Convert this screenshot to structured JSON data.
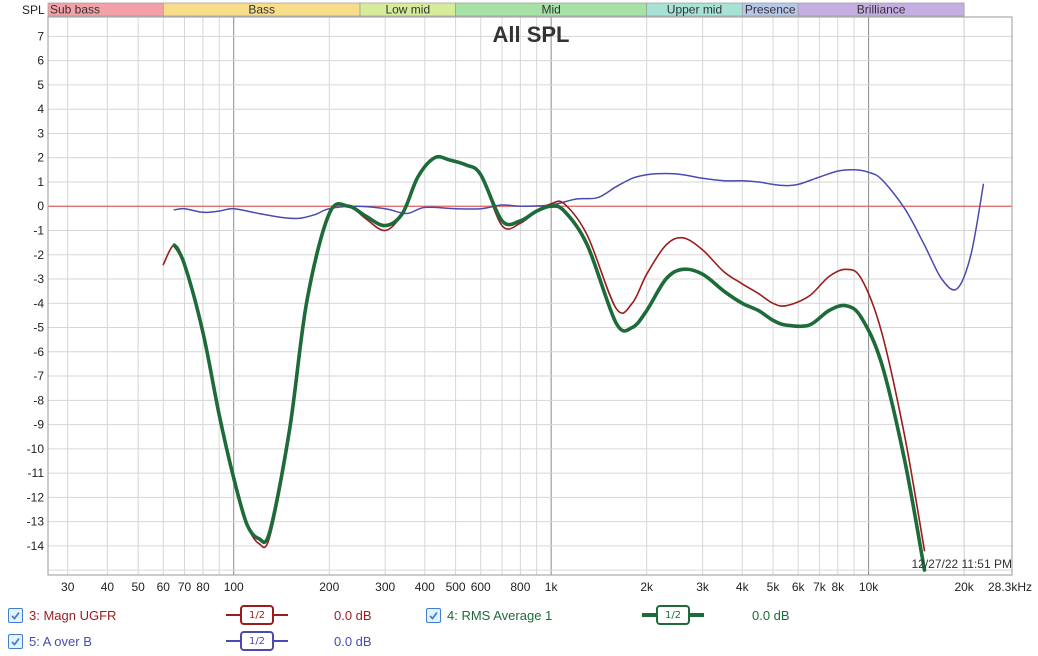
{
  "colors": {
    "series3": "#9b1c1c",
    "series4": "#1e6b3a",
    "series5": "#4a4ab0",
    "zero_line": "#e06060",
    "grid": "#d6d6d6",
    "grid_major": "#8a8a8a",
    "checkbox": "#3f7fd1"
  },
  "bands": [
    {
      "label": "Sub bass",
      "color": "#f4a0a8"
    },
    {
      "label": "Bass",
      "color": "#f7dc8a"
    },
    {
      "label": "Low mid",
      "color": "#d6ec9a"
    },
    {
      "label": "Mid",
      "color": "#a6e2a6"
    },
    {
      "label": "Upper mid",
      "color": "#a6e2d6"
    },
    {
      "label": "Presence",
      "color": "#b8c6ea"
    },
    {
      "label": "Brilliance",
      "color": "#c4aee2"
    }
  ],
  "timestamp": "12/27/22 11:51 PM",
  "legend": [
    {
      "checked": true,
      "label": "3: Magn UGFR",
      "smoothing": "1/2",
      "offset": "0.0 dB",
      "color_key": "series3"
    },
    {
      "checked": true,
      "label": "4: RMS Average 1",
      "smoothing": "1/2",
      "offset": "0.0 dB",
      "color_key": "series4"
    },
    {
      "checked": true,
      "label": "5: A over B",
      "smoothing": "1/2",
      "offset": "0.0 dB",
      "color_key": "series5"
    }
  ],
  "chart_data": {
    "type": "line",
    "title": "All SPL",
    "ylabel": "SPL",
    "xlabel": "",
    "xscale": "log",
    "xlim": [
      26,
      28300
    ],
    "ylim": [
      -15.2,
      7.8
    ],
    "grid": true,
    "x_ticks": [
      {
        "value": 30,
        "label": "30"
      },
      {
        "value": 40,
        "label": "40"
      },
      {
        "value": 50,
        "label": "50"
      },
      {
        "value": 60,
        "label": "60"
      },
      {
        "value": 70,
        "label": "70"
      },
      {
        "value": 80,
        "label": "80"
      },
      {
        "value": 100,
        "label": "100"
      },
      {
        "value": 200,
        "label": "200"
      },
      {
        "value": 300,
        "label": "300"
      },
      {
        "value": 400,
        "label": "400"
      },
      {
        "value": 500,
        "label": "500"
      },
      {
        "value": 600,
        "label": "600"
      },
      {
        "value": 800,
        "label": "800"
      },
      {
        "value": 1000,
        "label": "1k"
      },
      {
        "value": 2000,
        "label": "2k"
      },
      {
        "value": 3000,
        "label": "3k"
      },
      {
        "value": 4000,
        "label": "4k"
      },
      {
        "value": 5000,
        "label": "5k"
      },
      {
        "value": 6000,
        "label": "6k"
      },
      {
        "value": 7000,
        "label": "7k"
      },
      {
        "value": 8000,
        "label": "8k"
      },
      {
        "value": 10000,
        "label": "10k"
      },
      {
        "value": 20000,
        "label": "20k"
      },
      {
        "value": 28300,
        "label": "28.3kHz"
      }
    ],
    "y_ticks": [
      7,
      6,
      5,
      4,
      3,
      2,
      1,
      0,
      -1,
      -2,
      -3,
      -4,
      -5,
      -6,
      -7,
      -8,
      -9,
      -10,
      -11,
      -12,
      -13,
      -14
    ],
    "series": [
      {
        "name": "3: Magn UGFR",
        "color_key": "series3",
        "x": [
          60,
          65,
          70,
          80,
          90,
          100,
          110,
          120,
          130,
          150,
          170,
          200,
          230,
          260,
          300,
          340,
          380,
          430,
          480,
          540,
          600,
          700,
          800,
          900,
          1000,
          1100,
          1300,
          1600,
          1800,
          2000,
          2300,
          2600,
          3000,
          3500,
          4000,
          4500,
          5000,
          5500,
          6500,
          7500,
          8500,
          9500,
          11000,
          13000,
          15000
        ],
        "y": [
          -2.4,
          -1.6,
          -2.4,
          -5.2,
          -8.6,
          -11.2,
          -13.1,
          -13.9,
          -13.6,
          -9.4,
          -4.0,
          -0.3,
          0.0,
          -0.5,
          -1.0,
          -0.3,
          1.2,
          2.0,
          1.9,
          1.7,
          1.3,
          -0.8,
          -0.7,
          -0.2,
          0.1,
          0.1,
          -1.2,
          -4.2,
          -4.0,
          -2.8,
          -1.6,
          -1.3,
          -1.8,
          -2.7,
          -3.2,
          -3.6,
          -4.0,
          -4.1,
          -3.7,
          -2.9,
          -2.6,
          -3.0,
          -5.2,
          -9.5,
          -14.2
        ]
      },
      {
        "name": "4: RMS Average 1",
        "color_key": "series4",
        "x": [
          65,
          70,
          80,
          90,
          100,
          110,
          120,
          130,
          150,
          170,
          200,
          230,
          260,
          300,
          340,
          380,
          430,
          480,
          540,
          600,
          700,
          800,
          900,
          1000,
          1100,
          1300,
          1600,
          1800,
          2000,
          2300,
          2600,
          3000,
          3500,
          4000,
          4500,
          5000,
          5500,
          6500,
          7500,
          8500,
          9500,
          11000,
          13000,
          15000
        ],
        "y": [
          -1.6,
          -2.4,
          -5.2,
          -8.6,
          -11.2,
          -13.1,
          -13.7,
          -13.4,
          -9.2,
          -3.9,
          -0.3,
          0.0,
          -0.4,
          -0.8,
          -0.3,
          1.2,
          2.0,
          1.9,
          1.7,
          1.3,
          -0.6,
          -0.6,
          -0.2,
          0.0,
          -0.2,
          -1.6,
          -4.8,
          -5.0,
          -4.3,
          -3.0,
          -2.6,
          -2.8,
          -3.5,
          -4.0,
          -4.3,
          -4.7,
          -4.9,
          -4.9,
          -4.3,
          -4.1,
          -4.6,
          -6.5,
          -10.5,
          -15.0
        ]
      },
      {
        "name": "5: A over B",
        "color_key": "series5",
        "x": [
          65,
          70,
          80,
          90,
          100,
          120,
          140,
          160,
          180,
          200,
          240,
          300,
          350,
          400,
          500,
          600,
          700,
          800,
          1000,
          1200,
          1400,
          1600,
          1800,
          2000,
          2300,
          2600,
          3000,
          3500,
          4000,
          4500,
          5000,
          5500,
          6000,
          7000,
          8000,
          9000,
          10000,
          11000,
          13000,
          15000,
          17000,
          19000,
          21000,
          23000
        ],
        "y": [
          -0.15,
          -0.1,
          -0.25,
          -0.2,
          -0.1,
          -0.3,
          -0.45,
          -0.5,
          -0.35,
          -0.1,
          0.0,
          -0.1,
          -0.3,
          -0.05,
          -0.1,
          -0.1,
          0.05,
          0.0,
          0.05,
          0.3,
          0.35,
          0.8,
          1.15,
          1.3,
          1.35,
          1.3,
          1.15,
          1.05,
          1.05,
          1.0,
          0.9,
          0.85,
          0.9,
          1.2,
          1.45,
          1.5,
          1.4,
          1.1,
          -0.1,
          -1.6,
          -3.0,
          -3.4,
          -2.0,
          0.9
        ]
      }
    ]
  }
}
